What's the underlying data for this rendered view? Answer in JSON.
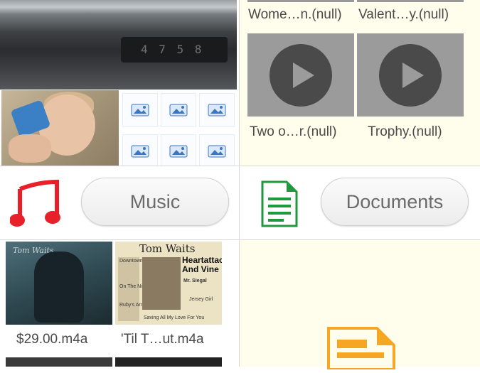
{
  "images": {
    "dashboard_display": "4 7 5 8",
    "placeholder_count": 6
  },
  "videos": {
    "top_labels": [
      "Wome…n.(null)",
      "Valent…y.(null)"
    ],
    "items": [
      {
        "label": "Two o…r.(null)"
      },
      {
        "label": "Trophy.(null)"
      }
    ]
  },
  "music": {
    "button_label": "Music",
    "icon": "music-note-icon",
    "icon_color": "#e8202a",
    "items": [
      {
        "label": "$29.00.m4a",
        "album_text": "Tom Waits"
      },
      {
        "label": "'Til T…ut.m4a",
        "album_title": "Tom Waits",
        "album_headline": "Heartattack And Vine",
        "album_tracks": [
          "Mr. Siegal",
          "On The Nickel",
          "Jersey Girl",
          "Saving All My Love For You",
          "Downtown",
          "Ruby's Arms"
        ]
      }
    ]
  },
  "documents": {
    "button_label": "Documents",
    "icon": "document-icon",
    "icon_color": "#1e9a3c",
    "preview_icon": "slideshow-doc-icon",
    "preview_color": "#f5a623"
  },
  "colors": {
    "cream": "#fffdeb",
    "divider": "#d8d8d8"
  }
}
